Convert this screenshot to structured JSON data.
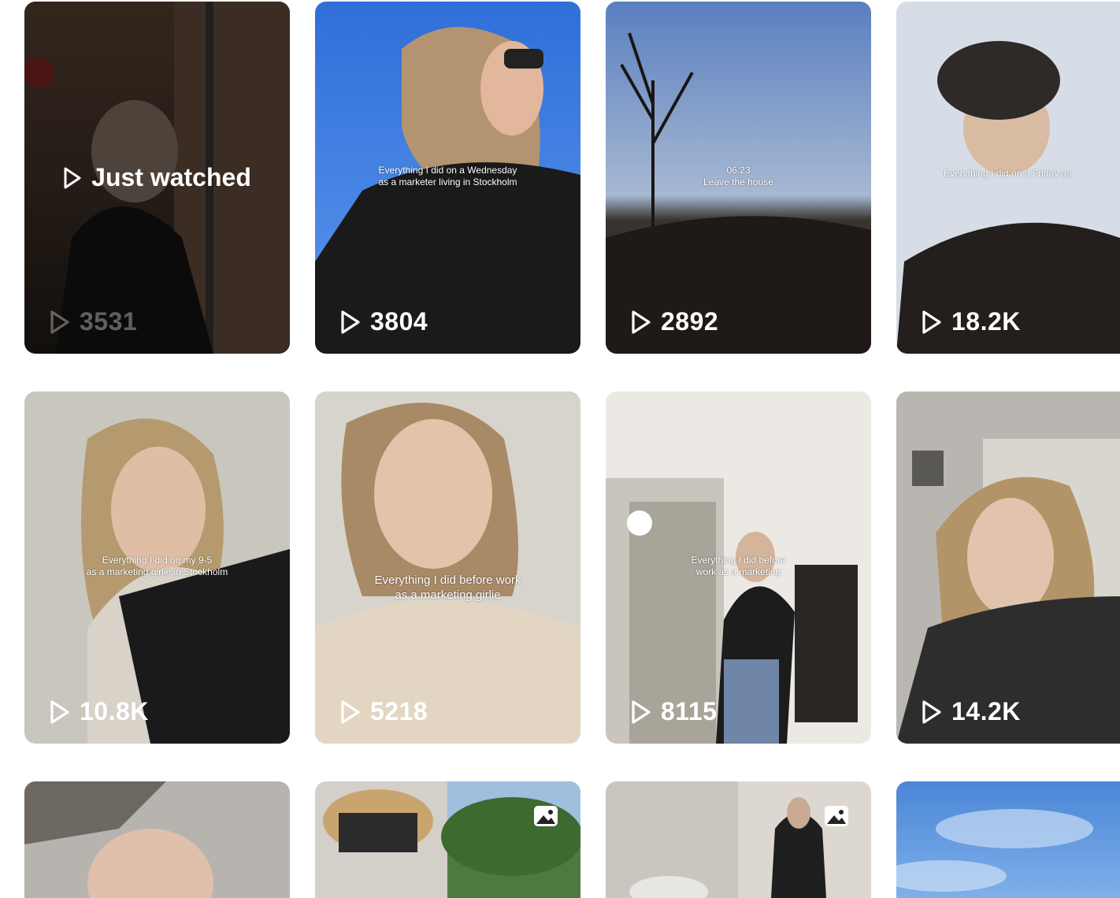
{
  "grid": {
    "items": [
      {
        "type": "video",
        "views": "3531",
        "caption_lines": [],
        "just_watched": "Just watched"
      },
      {
        "type": "video",
        "views": "3804",
        "caption_lines": [
          "Everything I did on a Wednesday",
          "as a marketer living in Stockholm"
        ]
      },
      {
        "type": "video",
        "views": "2892",
        "caption_lines": [
          "06.23",
          "Leave the house"
        ]
      },
      {
        "type": "video",
        "views": "18.2K",
        "caption_lines": [
          "Everything I did on a Friday as"
        ]
      },
      {
        "type": "video",
        "views": "10.8K",
        "caption_lines": [
          "Everything I did on my 9-5",
          "as a marketing girlie in Stockholm"
        ]
      },
      {
        "type": "video",
        "views": "5218",
        "caption_lines": [
          "Everything I did before work",
          "as a marketing girlie"
        ]
      },
      {
        "type": "video",
        "views": "8115",
        "caption_lines": [
          "Everything I did before",
          "work as a marketing"
        ]
      },
      {
        "type": "video",
        "views": "14.2K",
        "caption_lines": []
      },
      {
        "type": "video",
        "views": "",
        "caption_lines": []
      },
      {
        "type": "photo",
        "badge": "photo-carousel-icon"
      },
      {
        "type": "photo",
        "badge": "photo-carousel-icon"
      },
      {
        "type": "video",
        "views": "",
        "caption_lines": []
      }
    ]
  },
  "icons": {
    "play": "play-icon",
    "photo": "image-icon"
  }
}
